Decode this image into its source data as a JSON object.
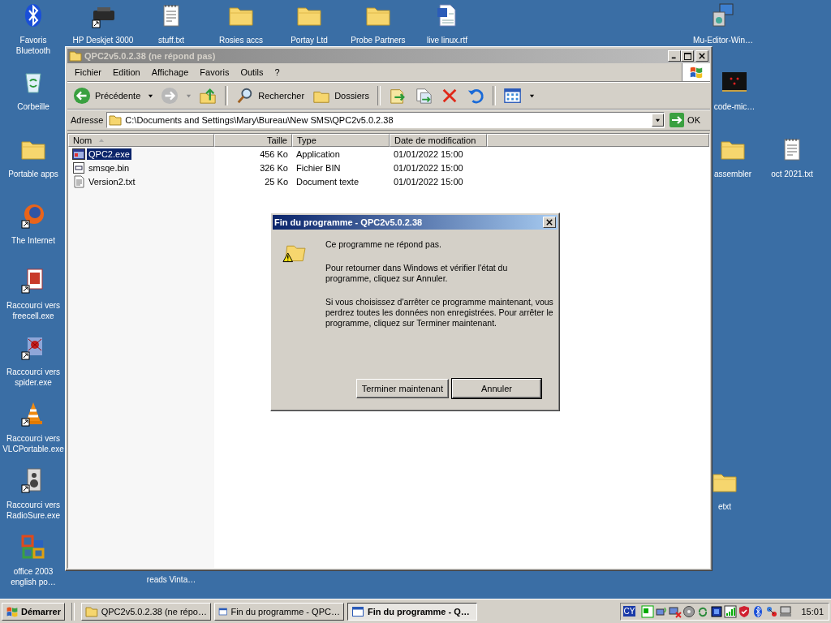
{
  "desktop_icons": [
    {
      "label": "Favoris Bluetooth",
      "kind": "bluetooth"
    },
    {
      "label": "HP Deskjet 3000",
      "kind": "printer"
    },
    {
      "label": "stuff.txt",
      "kind": "text"
    },
    {
      "label": "Rosies accs",
      "kind": "folder"
    },
    {
      "label": "Portay Ltd",
      "kind": "folder"
    },
    {
      "label": "Probe Partners",
      "kind": "folder"
    },
    {
      "label": "live linux.rtf",
      "kind": "document"
    },
    {
      "label": "Mu-Editor-Win…",
      "kind": "installer"
    },
    {
      "label": "Corbeille",
      "kind": "recycle"
    },
    {
      "label": "Portable apps",
      "kind": "folder"
    },
    {
      "label": "The Internet",
      "kind": "browser"
    },
    {
      "label": "Raccourci vers freecell.exe",
      "kind": "cards"
    },
    {
      "label": "Raccourci vers spider.exe",
      "kind": "spider"
    },
    {
      "label": "Raccourci vers VLCPortable.exe",
      "kind": "cone"
    },
    {
      "label": "Raccourci vers RadioSure.exe",
      "kind": "speaker"
    },
    {
      "label": "office 2003 english po…",
      "kind": "office"
    },
    {
      "label": "code-mic…",
      "kind": "board"
    },
    {
      "label": "assembler",
      "kind": "folder"
    },
    {
      "label": "oct 2021.txt",
      "kind": "text"
    },
    {
      "label": "etxt",
      "kind": "folder"
    },
    {
      "label": "reads Vinta…"
    }
  ],
  "explorer_window": {
    "title": "QPC2v5.0.2.38 (ne répond pas)",
    "active": false,
    "menu": [
      "Fichier",
      "Edition",
      "Affichage",
      "Favoris",
      "Outils",
      "?"
    ],
    "toolbar": {
      "back": "Précédente",
      "search": "Rechercher",
      "folders": "Dossiers"
    },
    "address": {
      "label": "Adresse",
      "value": "C:\\Documents and Settings\\Mary\\Bureau\\New SMS\\QPC2v5.0.2.38",
      "go": "OK"
    },
    "columns": [
      "Nom",
      "Taille",
      "Type",
      "Date de modification"
    ],
    "rows": [
      {
        "name": "QPC2.exe",
        "size": "456 Ko",
        "type": "Application",
        "date": "01/01/2022 15:00",
        "kind": "exe",
        "selected": true
      },
      {
        "name": "smsqe.bin",
        "size": "326 Ko",
        "type": "Fichier BIN",
        "date": "01/01/2022 15:00",
        "kind": "bin",
        "selected": false
      },
      {
        "name": "Version2.txt",
        "size": "25 Ko",
        "type": "Document texte",
        "date": "01/01/2022 15:00",
        "kind": "txt",
        "selected": false
      }
    ]
  },
  "dialog": {
    "title": "Fin du programme - QPC2v5.0.2.38",
    "active": true,
    "paragraphs": [
      "Ce programme ne répond pas.",
      "Pour retourner dans Windows et vérifier l'état du programme, cliquez sur Annuler.",
      "Si vous choisissez d'arrêter ce programme maintenant, vous perdrez toutes les données non enregistrées. Pour arrêter le programme, cliquez sur Terminer maintenant."
    ],
    "buttons": [
      {
        "label": "Terminer maintenant",
        "default": false
      },
      {
        "label": "Annuler",
        "default": true
      }
    ]
  },
  "taskbar": {
    "start": "Démarrer",
    "tasks": [
      {
        "label": "QPC2v5.0.2.38 (ne répo…",
        "kind": "folder",
        "selected": false
      },
      {
        "label": "Fin du programme - QPC…",
        "kind": "window",
        "selected": false
      },
      {
        "label": "Fin du programme - Q…",
        "kind": "window",
        "selected": true
      }
    ],
    "language": "CY",
    "clock": "15:01"
  }
}
